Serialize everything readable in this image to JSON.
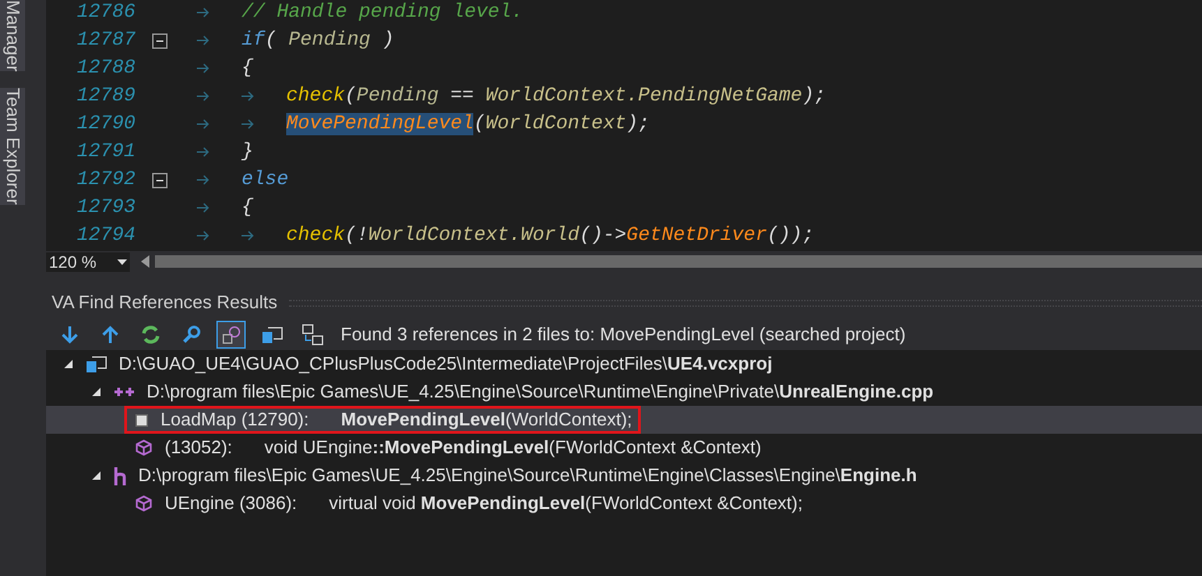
{
  "side_tabs": [
    {
      "label": "Manager"
    },
    {
      "label": "Team Explorer"
    }
  ],
  "editor": {
    "lines": [
      {
        "number": "12786",
        "fold": false,
        "tokens": [
          {
            "t": "// Handle pending level.",
            "kind": "comment"
          }
        ]
      },
      {
        "number": "12787",
        "fold": true,
        "tokens": [
          {
            "t": "if",
            "kind": "keyword"
          },
          {
            "t": "( ",
            "kind": "punct"
          },
          {
            "t": "Pending",
            "kind": "param"
          },
          {
            "t": " )",
            "kind": "punct"
          }
        ]
      },
      {
        "number": "12788",
        "fold": false,
        "tokens": [
          {
            "t": "{",
            "kind": "punct"
          }
        ],
        "children": [
          {
            "number": "12789",
            "fold": false,
            "tokens": [
              {
                "t": "check",
                "kind": "func"
              },
              {
                "t": "(",
                "kind": "punct"
              },
              {
                "t": "Pending",
                "kind": "param"
              },
              {
                "t": " == ",
                "kind": "punct"
              },
              {
                "t": "WorldContext.PendingNetGame",
                "kind": "member"
              },
              {
                "t": ");",
                "kind": "punct"
              }
            ]
          },
          {
            "number": "12790",
            "fold": false,
            "tokens": [
              {
                "t": "MovePendingLevel",
                "kind": "method",
                "highlighted": true
              },
              {
                "t": "(",
                "kind": "punct"
              },
              {
                "t": "WorldContext",
                "kind": "member"
              },
              {
                "t": ");",
                "kind": "punct"
              }
            ]
          }
        ]
      },
      {
        "number": "12791",
        "fold": false,
        "tokens": [
          {
            "t": "}",
            "kind": "punct"
          }
        ]
      },
      {
        "number": "12792",
        "fold": true,
        "tokens": [
          {
            "t": "else",
            "kind": "keyword"
          }
        ]
      },
      {
        "number": "12793",
        "fold": false,
        "tokens": [
          {
            "t": "{",
            "kind": "punct"
          }
        ],
        "children": [
          {
            "number": "12794",
            "fold": false,
            "tokens": [
              {
                "t": "check",
                "kind": "func"
              },
              {
                "t": "(!",
                "kind": "punct"
              },
              {
                "t": "WorldContext.World",
                "kind": "member"
              },
              {
                "t": "()->",
                "kind": "punct"
              },
              {
                "t": "GetNetDriver",
                "kind": "method"
              },
              {
                "t": "());",
                "kind": "punct"
              }
            ]
          }
        ]
      }
    ],
    "zoom": "120 %"
  },
  "panel": {
    "title": "VA Find References Results",
    "toolbar": [
      {
        "kind": "down",
        "on": false
      },
      {
        "kind": "up",
        "on": false
      },
      {
        "kind": "refresh",
        "on": false
      },
      {
        "kind": "find",
        "on": false
      },
      {
        "kind": "filter",
        "on": true
      },
      {
        "kind": "project",
        "on": false
      },
      {
        "kind": "swap",
        "on": false
      }
    ],
    "summary": "Found 3 references in 2 files to: MovePendingLevel (searched project)",
    "tree": [
      {
        "kind": "project",
        "text": "D:\\GUAO_UE4\\GUAO_CPlusPlusCode25\\Intermediate\\ProjectFiles\\**UE4.vcxproj**",
        "expanded": true,
        "children": [
          {
            "kind": "cpp",
            "text": "D:\\program files\\Epic Games\\UE_4.25\\Engine\\Source\\Runtime\\Engine\\Private\\**UnrealEngine.cpp**",
            "expanded": true,
            "children": [
              {
                "kind": "call",
                "selected": true,
                "marked": true,
                "prefix": "LoadMap (12790):",
                "code": "**MovePendingLevel**(WorldContext);"
              },
              {
                "kind": "definition",
                "selected": false,
                "marked": false,
                "prefix": "(13052):",
                "code": "void UEngine**::MovePendingLevel**(FWorldContext &Context)"
              }
            ]
          },
          {
            "kind": "header",
            "text": "D:\\program files\\Epic Games\\UE_4.25\\Engine\\Source\\Runtime\\Engine\\Classes\\Engine\\**Engine.h**",
            "expanded": true,
            "children": [
              {
                "kind": "definition",
                "selected": false,
                "marked": false,
                "prefix": "UEngine (3086):",
                "code": "virtual void **MovePendingLevel**(FWorldContext &Context);"
              }
            ]
          }
        ]
      }
    ]
  }
}
